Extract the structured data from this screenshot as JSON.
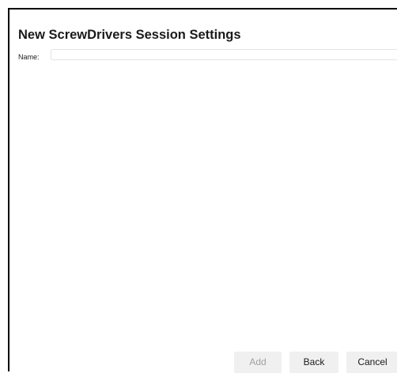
{
  "dialog": {
    "title": "New ScrewDrivers Session Settings",
    "name_label": "Name:",
    "name_value": "",
    "name_placeholder": ""
  },
  "footer": {
    "add_label": "Add",
    "add_enabled": false,
    "back_label": "Back",
    "cancel_label": "Cancel"
  }
}
